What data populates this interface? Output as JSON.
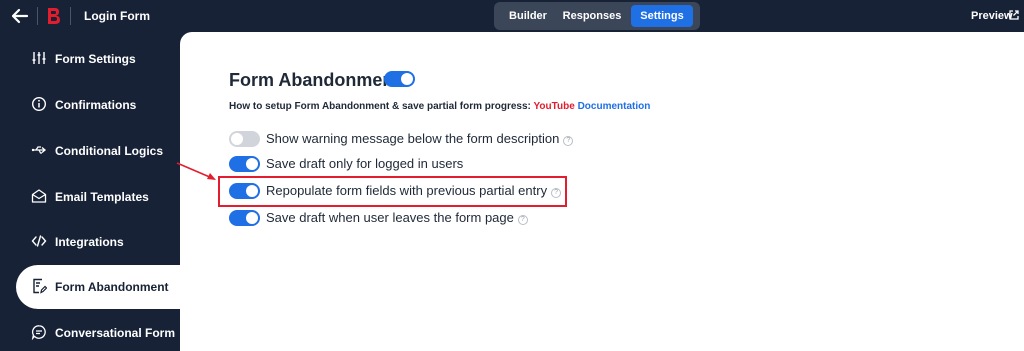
{
  "header": {
    "form_title": "Login Form",
    "tabs": [
      {
        "label": "Builder"
      },
      {
        "label": "Responses"
      },
      {
        "label": "Settings",
        "active": true
      }
    ],
    "preview_label": "Preview"
  },
  "sidebar": {
    "items": [
      {
        "label": "Form Settings",
        "icon": "sliders-icon"
      },
      {
        "label": "Confirmations",
        "icon": "info-icon"
      },
      {
        "label": "Conditional Logics",
        "icon": "usb-branch-icon"
      },
      {
        "label": "Email Templates",
        "icon": "envelope-open-icon"
      },
      {
        "label": "Integrations",
        "icon": "code-icon"
      },
      {
        "label": "Form Abandonment",
        "icon": "document-edit-icon",
        "active": true
      },
      {
        "label": "Conversational Form",
        "icon": "chat-bubble-icon"
      }
    ]
  },
  "main": {
    "title": "Form Abandonment",
    "enabled": true,
    "help_text": "How to setup Form Abandonment & save partial form progress:",
    "youtube_label": "YouTube",
    "documentation_label": "Documentation",
    "options": [
      {
        "label": "Show warning message below the form description",
        "on": false,
        "help": true
      },
      {
        "label": "Save draft only for logged in users",
        "on": true,
        "help": false
      },
      {
        "label": "Repopulate form fields with previous partial entry",
        "on": true,
        "help": true
      },
      {
        "label": "Save draft when user leaves the form page",
        "on": true,
        "help": true
      }
    ]
  },
  "colors": {
    "dark_bg": "#172236",
    "accent": "#1f6fe5",
    "highlight": "#e11d2e"
  }
}
